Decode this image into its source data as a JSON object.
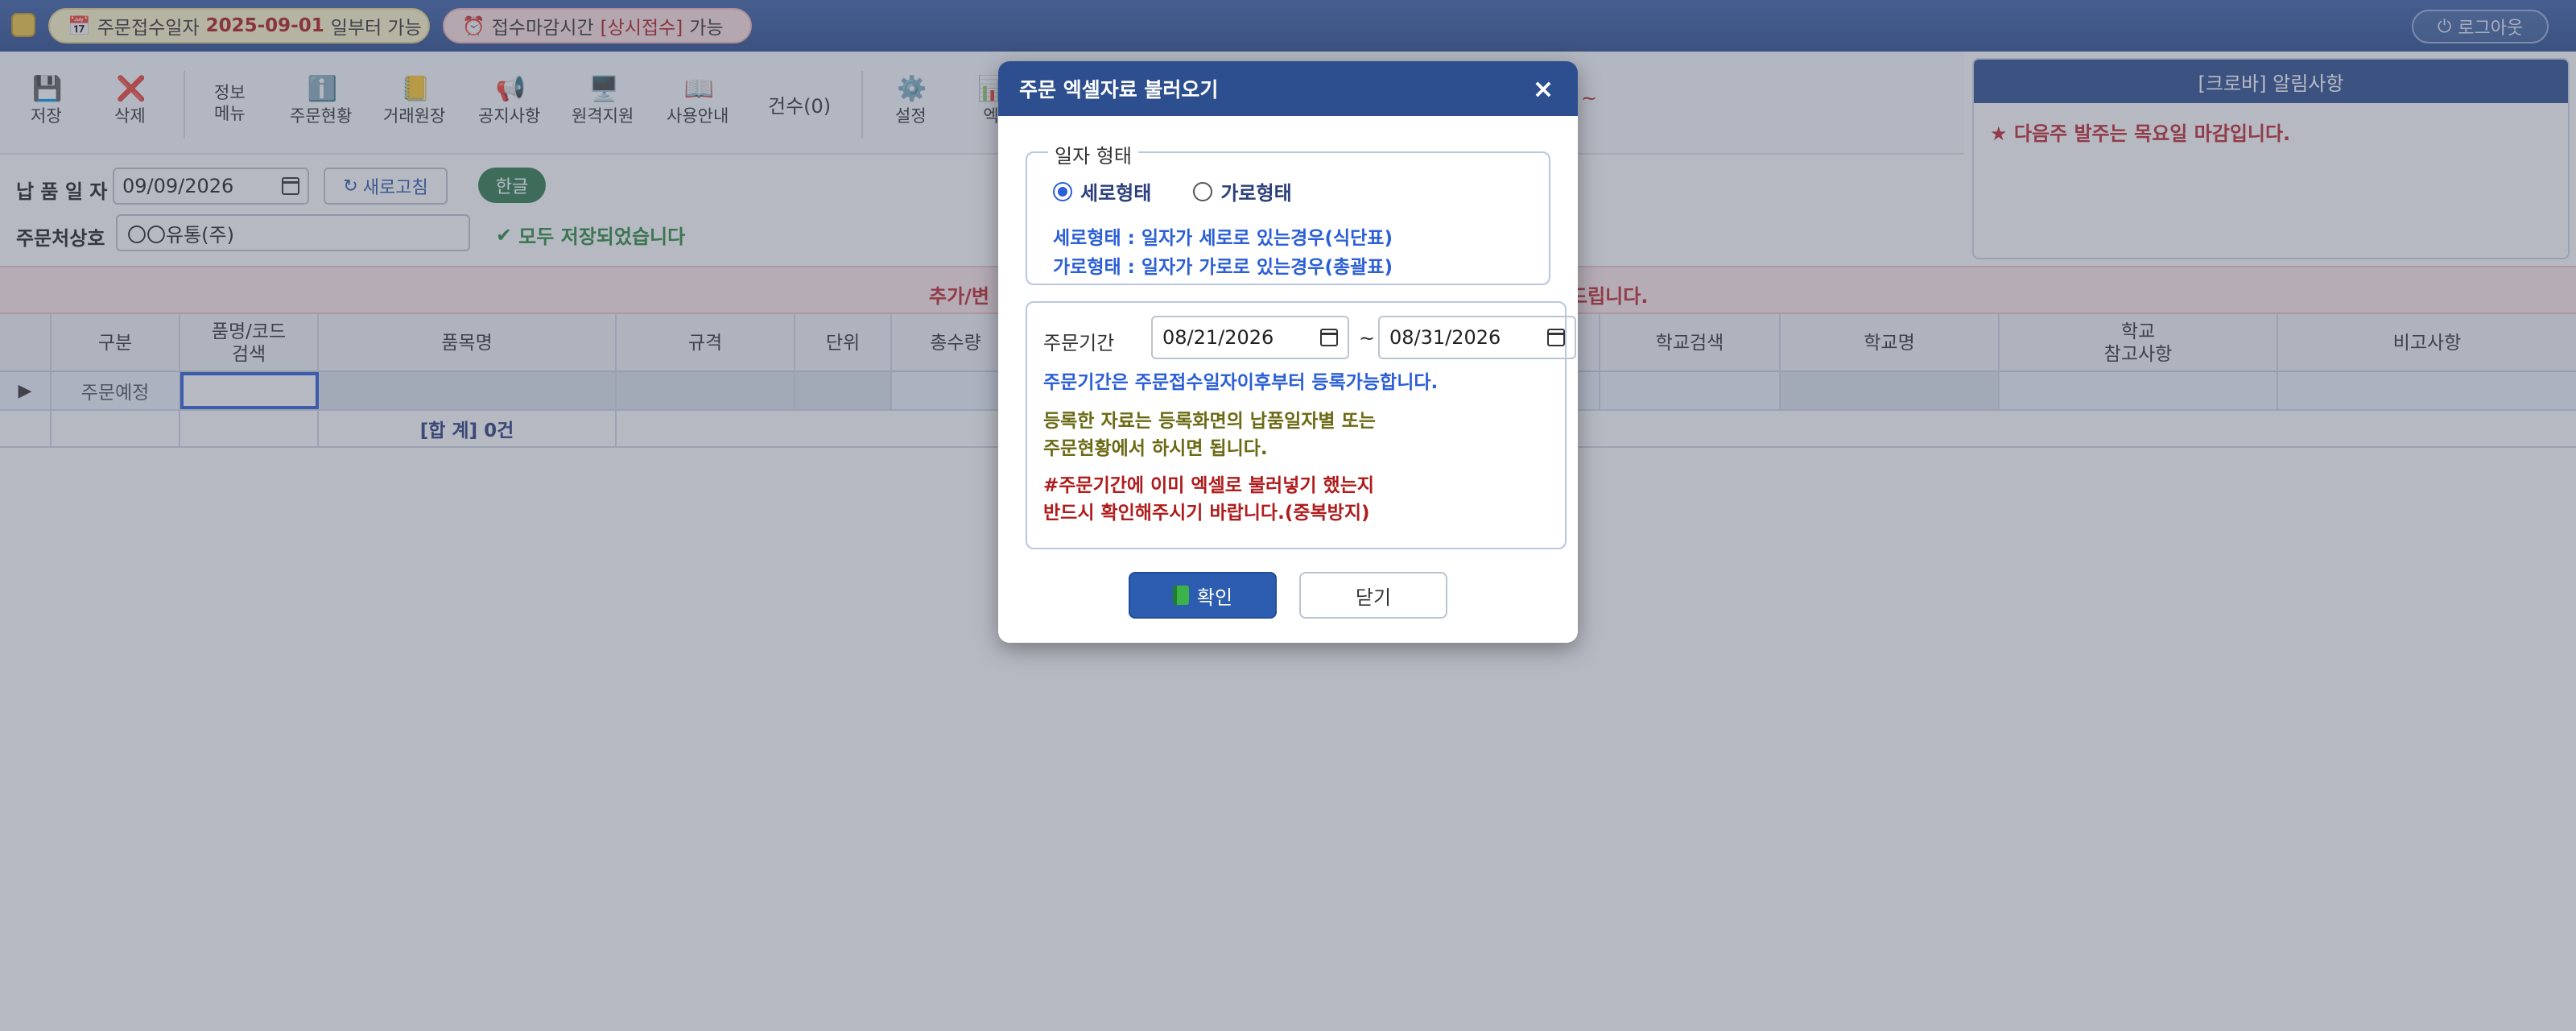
{
  "header": {
    "order_date_prefix": "주문접수일자",
    "order_date_value": "2025-09-01",
    "order_date_suffix": "일부터 가능",
    "deadline_prefix": "접수마감시간",
    "deadline_value": "[상시접수]",
    "deadline_suffix": "가능",
    "logout_label": "로그아웃"
  },
  "toolbar": {
    "save": "저장",
    "delete": "삭제",
    "info_menu_1": "정보",
    "info_menu_2": "메뉴",
    "order_status": "주문현황",
    "ledger": "거래원장",
    "notice": "공지사항",
    "remote": "원격지원",
    "guide": "사용안내",
    "count_label": "건수(0)",
    "settings": "설정",
    "excel_partial": "엑",
    "tilde": "~"
  },
  "form": {
    "delivery_date_label": "납 품 일 자",
    "delivery_date_value": "09/09/2026",
    "refresh_label": "새로고침",
    "hangul_label": "한글",
    "vendor_label": "주문처상호",
    "vendor_value": "〇〇유통(주)",
    "saved_message": "모두 저장되었습니다"
  },
  "notice_panel": {
    "title": "[크로바] 알림사항",
    "message": "★ 다음주 발주는 목요일 마감입니다."
  },
  "banner": {
    "left_text": "추가/변",
    "right_text": "드립니다."
  },
  "grid": {
    "headers": {
      "category": "구분",
      "code_search_1": "품명/코드",
      "code_search_2": "검색",
      "item_name": "품목명",
      "spec": "규격",
      "unit": "단위",
      "total_qty": "총수량",
      "school_search": "학교검색",
      "school_name": "학교명",
      "school_ref_1": "학교",
      "school_ref_2": "참고사항",
      "remarks": "비고사항"
    },
    "row1_category": "주문예정",
    "total_label": "[합 계] 0건"
  },
  "modal": {
    "title": "주문 엑셀자료 불러오기",
    "close_symbol": "×",
    "date_format_legend": "일자 형태",
    "radio_vertical": "세로형태",
    "radio_horizontal": "가로형태",
    "selected_format": "세로형태",
    "desc_vertical": "세로형태 : 일자가 세로로 있는경우(식단표)",
    "desc_horizontal": "가로형태 : 일자가 가로로 있는경우(총괄표)",
    "period_label": "주문기간",
    "period_start": "08/21/2026",
    "period_end": "08/31/2026",
    "tilde": "~",
    "msg_blue": "주문기간은 주문접수일자이후부터 등록가능합니다.",
    "msg_olive_1": "등록한 자료는 등록화면의 납품일자별 또는",
    "msg_olive_2": "주문현황에서 하시면 됩니다.",
    "msg_red_1": "#주문기간에 이미 엑셀로 불러넣기 했는지",
    "msg_red_2": "반드시 확인해주시기 바랍니다.(중복방지)",
    "ok_label": "확인",
    "close_label": "닫기"
  }
}
